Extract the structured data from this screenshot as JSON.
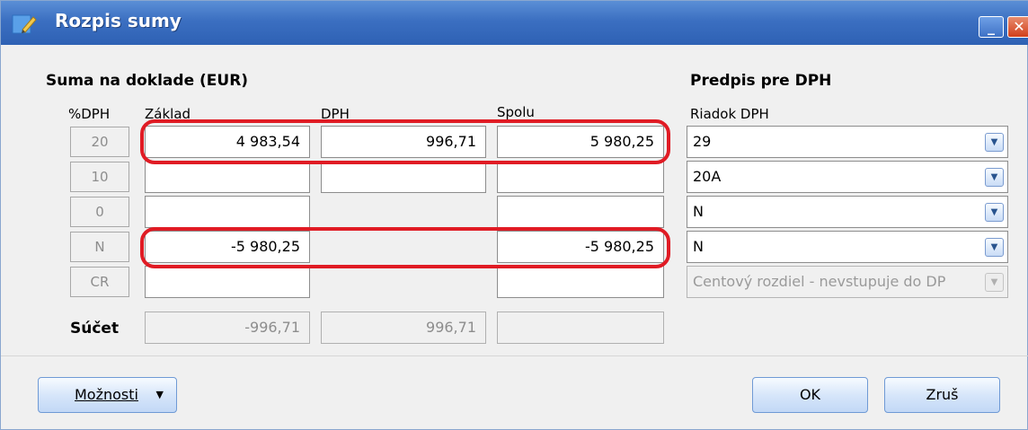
{
  "window": {
    "title": "Rozpis sumy"
  },
  "sum_section": {
    "title": "Suma na doklade (EUR)",
    "columns": {
      "rate": "%DPH",
      "base": "Základ",
      "vat": "DPH",
      "total": "Spolu"
    },
    "rows": [
      {
        "rate": "20",
        "base": "4 983,54",
        "vat": "996,71",
        "total": "5 980,25"
      },
      {
        "rate": "10",
        "base": "",
        "vat": "",
        "total": ""
      },
      {
        "rate": "0",
        "base": "",
        "total": ""
      },
      {
        "rate": "N",
        "base": "-5 980,25",
        "total": "-5 980,25"
      },
      {
        "rate": "CR",
        "base": "",
        "total": ""
      }
    ],
    "sum": {
      "label": "Súčet",
      "base": "-996,71",
      "vat": "996,71",
      "total": ""
    }
  },
  "vat_section": {
    "title": "Predpis pre DPH",
    "column": "Riadok DPH",
    "rows": [
      "29",
      "20A",
      "N",
      "N",
      "Centový rozdiel - nevstupuje do DP"
    ]
  },
  "buttons": {
    "options": "Možnosti",
    "ok": "OK",
    "cancel": "Zruš"
  },
  "colors": {
    "titlebar": "#3b6fc1",
    "highlight": "#e01b24"
  }
}
